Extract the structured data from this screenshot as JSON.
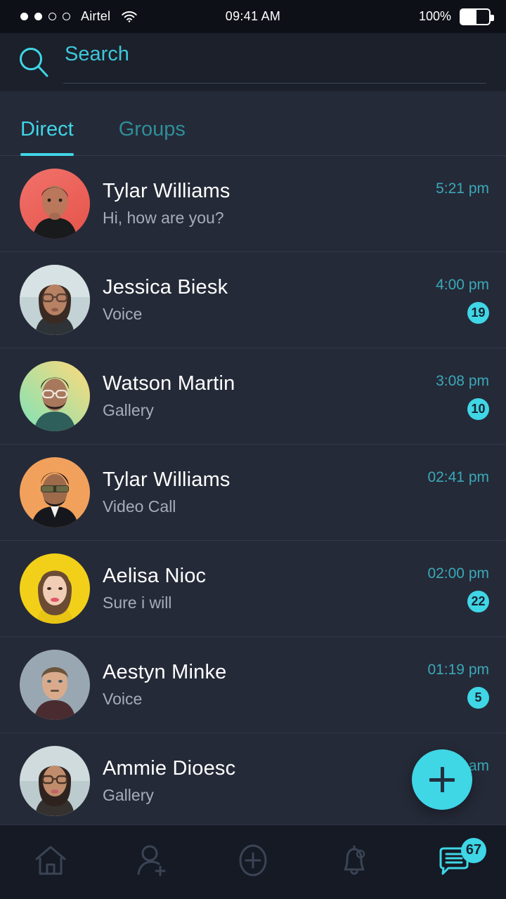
{
  "status_bar": {
    "signal_dots_total": 4,
    "signal_dots_filled": 2,
    "carrier": "Airtel",
    "wifi_icon": "wifi-icon",
    "time": "09:41 AM",
    "battery_percent": "100%",
    "battery_icon": "battery-icon"
  },
  "search": {
    "icon": "search-icon",
    "placeholder": "Search",
    "value": ""
  },
  "tabs": {
    "items": [
      {
        "label": "Direct",
        "active": true
      },
      {
        "label": "Groups",
        "active": false
      }
    ]
  },
  "chats": [
    {
      "name": "Tylar Williams",
      "preview": "Hi, how are you?",
      "time": "5:21 pm",
      "badge": "",
      "avatar": "avatar-tylar-williams-red"
    },
    {
      "name": "Jessica Biesk",
      "preview": "Voice",
      "time": "4:00 pm",
      "badge": "19",
      "avatar": "avatar-jessica-biesk"
    },
    {
      "name": "Watson Martin",
      "preview": "Gallery",
      "time": "3:08 pm",
      "badge": "10",
      "avatar": "avatar-watson-martin"
    },
    {
      "name": "Tylar Williams",
      "preview": "Video Call",
      "time": "02:41 pm",
      "badge": "",
      "avatar": "avatar-tylar-williams-orange"
    },
    {
      "name": "Aelisa Nioc",
      "preview": "Sure i will",
      "time": "02:00 pm",
      "badge": "22",
      "avatar": "avatar-aelisa-nioc"
    },
    {
      "name": "Aestyn Minke",
      "preview": "Voice",
      "time": "01:19 pm",
      "badge": "5",
      "avatar": "avatar-aestyn-minke"
    },
    {
      "name": "Ammie Dioesc",
      "preview": "Gallery",
      "time": "am",
      "badge": "",
      "avatar": "avatar-ammie-dioesc"
    }
  ],
  "fab": {
    "icon": "plus-icon",
    "label": "+"
  },
  "bottom_nav": {
    "items": [
      {
        "icon": "home-icon",
        "active": false,
        "badge": ""
      },
      {
        "icon": "add-person-icon",
        "active": false,
        "badge": ""
      },
      {
        "icon": "plus-circle-icon",
        "active": false,
        "badge": ""
      },
      {
        "icon": "bell-icon",
        "active": false,
        "badge": ""
      },
      {
        "icon": "chat-icon",
        "active": true,
        "badge": "67"
      }
    ]
  },
  "colors": {
    "background": "#252a38",
    "header": "#1b202b",
    "status_bar": "#0d1017",
    "accent": "#3fd6e6",
    "accent_dim": "#2e8e98",
    "time_text": "#3aa9b8",
    "preview_text": "#a7acb8",
    "nav_bar": "#151a24",
    "nav_icon": "#3b4455"
  }
}
